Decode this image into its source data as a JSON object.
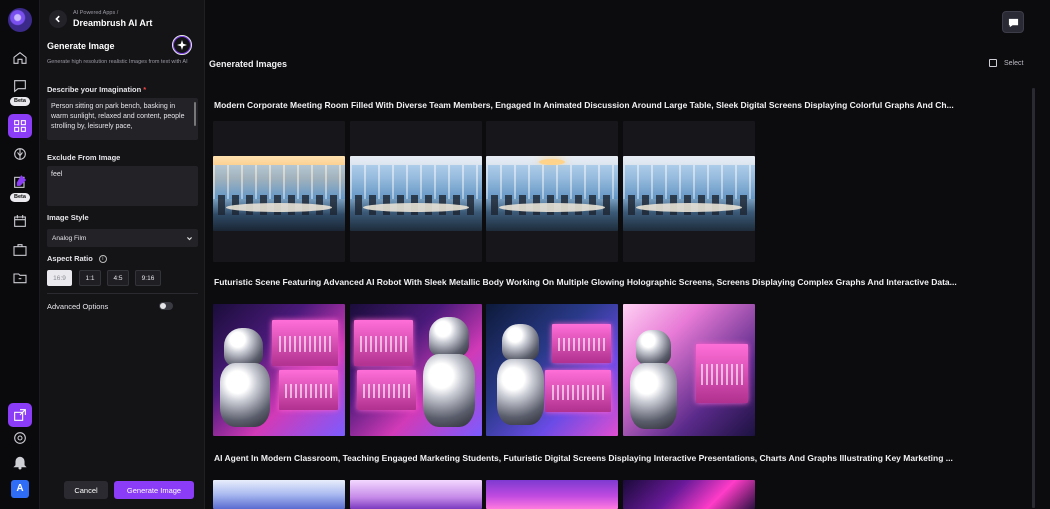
{
  "sidebar": {
    "items": [
      {
        "icon": "home-icon"
      },
      {
        "icon": "chat-icon",
        "badge": "Beta"
      },
      {
        "icon": "apps-grid-icon",
        "active": true
      },
      {
        "icon": "brain-icon"
      },
      {
        "icon": "edit-doc-icon",
        "badge": "Beta"
      },
      {
        "icon": "calendar-icon"
      },
      {
        "icon": "briefcase-icon"
      },
      {
        "icon": "folder-icon"
      }
    ],
    "bottom": [
      {
        "icon": "share-icon",
        "active": true
      },
      {
        "icon": "settings-icon"
      },
      {
        "icon": "bell-icon"
      }
    ],
    "avatar_letter": "A"
  },
  "panel": {
    "breadcrumb": "AI Powered Apps /",
    "app_name": "Dreambrush AI Art",
    "title": "Generate Image",
    "subtitle": "Generate high resolution realistic Images from text with AI",
    "describe_label": "Describe your Imagination",
    "describe_required": "*",
    "describe_value": "Person sitting on park bench, basking in warm sunlight, relaxed and content, people strolling by, leisurely pace,",
    "exclude_label": "Exclude From Image",
    "exclude_value": "feel",
    "style_label": "Image Style",
    "style_value": "Analog Film",
    "aspect_label": "Aspect Ratio",
    "aspect_info": "i",
    "aspect_options": [
      "16:9",
      "1:1",
      "4:5",
      "9:16"
    ],
    "aspect_selected": "16:9",
    "advanced_label": "Advanced Options",
    "advanced_enabled": false,
    "cancel_label": "Cancel",
    "generate_label": "Generate Image"
  },
  "main": {
    "title": "Generated Images",
    "select_label": "Select",
    "groups": [
      {
        "title": "Modern Corporate Meeting Room Filled With Diverse Team Members, Engaged In Animated Discussion Around Large Table, Sleek Digital Screens Displaying Colorful Graphs And Ch...",
        "image_count": 4
      },
      {
        "title": "Futuristic Scene Featuring Advanced AI Robot With Sleek Metallic Body Working On Multiple Glowing Holographic Screens, Screens Displaying Complex Graphs And Interactive Data...",
        "image_count": 4
      },
      {
        "title": "AI Agent In Modern Classroom, Teaching Engaged Marketing Students, Futuristic Digital Screens Displaying Interactive Presentations, Charts And Graphs Illustrating Key Marketing ...",
        "image_count": 4
      }
    ]
  },
  "colors": {
    "accent": "#8b3cf6",
    "background": "#0c0c0e",
    "panel": "#141417",
    "required": "#ef4444"
  }
}
